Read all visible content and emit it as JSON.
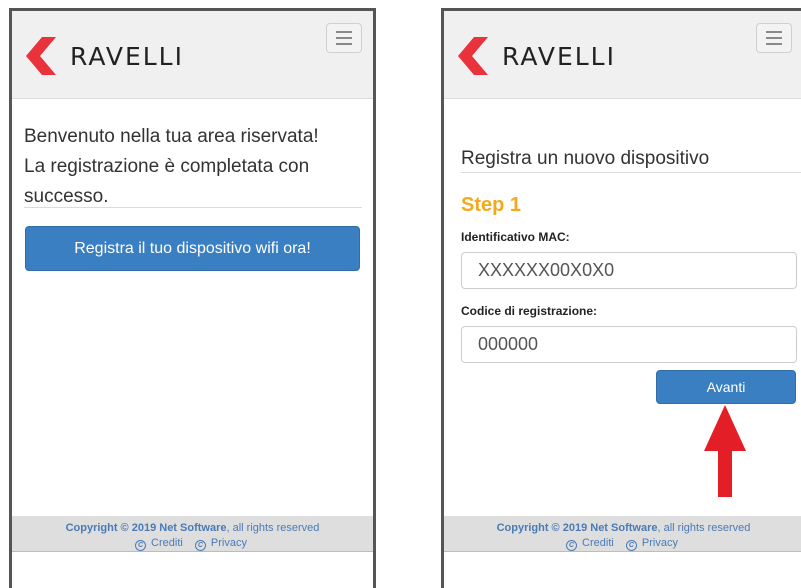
{
  "brand": {
    "name": "RAVELLI",
    "logo_color": "#e8323c"
  },
  "accent_colors": {
    "primary_button": "#3a7fc1",
    "step_title": "#f5a81d",
    "annotation_arrow": "#e41e26"
  },
  "left_screen": {
    "welcome_line1": "Benvenuto nella tua area riservata!",
    "welcome_line2": "La registrazione è completata con",
    "welcome_line3": "successo.",
    "register_button": "Registra il tuo dispositivo wifi ora!"
  },
  "right_screen": {
    "subtitle": "Registra un nuovo dispositivo",
    "step_title": "Step 1",
    "mac_label": "Identificativo MAC:",
    "mac_value": "XXXXXX00X0X0",
    "code_label": "Codice di registrazione:",
    "code_value": "000000",
    "next_button": "Avanti"
  },
  "footer": {
    "copyright_bold": "Copyright © 2019 Net Software",
    "copyright_rest": ", all rights reserved",
    "credits": "Crediti",
    "privacy": "Privacy",
    "link_icon": "copyright-circle-icon"
  },
  "menu_icon": "hamburger-icon",
  "annotation_icon": "red-up-arrow-icon"
}
